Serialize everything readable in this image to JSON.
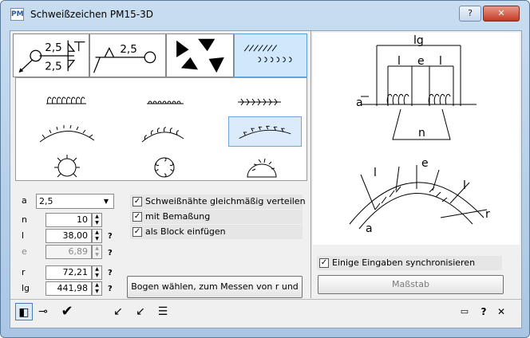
{
  "window": {
    "title": "Schweißzeichen  PM15-3D",
    "app_icon_text": "PM",
    "help_label": "?",
    "close_label": "✕"
  },
  "tabs": [
    {
      "name": "tab-fillet-weld-double",
      "texts": [
        "2,5",
        "2,5"
      ]
    },
    {
      "name": "tab-fillet-weld-single",
      "texts": [
        "2,5"
      ]
    },
    {
      "name": "tab-weld-triangles",
      "texts": []
    },
    {
      "name": "tab-seam-patterns",
      "texts": []
    }
  ],
  "gallery": [
    {
      "name": "straight-seam-1",
      "selected": false
    },
    {
      "name": "straight-seam-2",
      "selected": false
    },
    {
      "name": "straight-seam-3",
      "selected": false
    },
    {
      "name": "arc-seam-1",
      "selected": false
    },
    {
      "name": "arc-seam-2",
      "selected": false
    },
    {
      "name": "arc-seam-3",
      "selected": true
    },
    {
      "name": "circle-seam-1",
      "selected": false
    },
    {
      "name": "circle-seam-2",
      "selected": false
    },
    {
      "name": "circle-seam-3",
      "selected": false
    }
  ],
  "params": {
    "a_label": "a",
    "a_value": "2,5",
    "n_label": "n",
    "n_value": "10",
    "l_label": "l",
    "l_value": "38,00",
    "e_label": "e",
    "e_value": "6,89",
    "r_label": "r",
    "r_value": "72,21",
    "lg_label": "lg",
    "lg_value": "441,98",
    "help_mark": "?"
  },
  "options": {
    "distribute": "Schweißnähte gleichmäßig verteilen",
    "dimensioning": "mit Bemaßung",
    "as_block": "als Block einfügen",
    "sync": "Einige Eingaben synchronisieren",
    "check_mark": "✓"
  },
  "buttons": {
    "measure": "Bogen wählen, zum Messen von r und lg",
    "scale": "Maßstab"
  },
  "preview": {
    "labels": {
      "lg": "lg",
      "l": "l",
      "e": "e",
      "a": "a",
      "n": "n",
      "r": "r"
    }
  },
  "toolbar": {
    "minimize_label": "▭",
    "help_label": "?",
    "close_label": "✕"
  }
}
